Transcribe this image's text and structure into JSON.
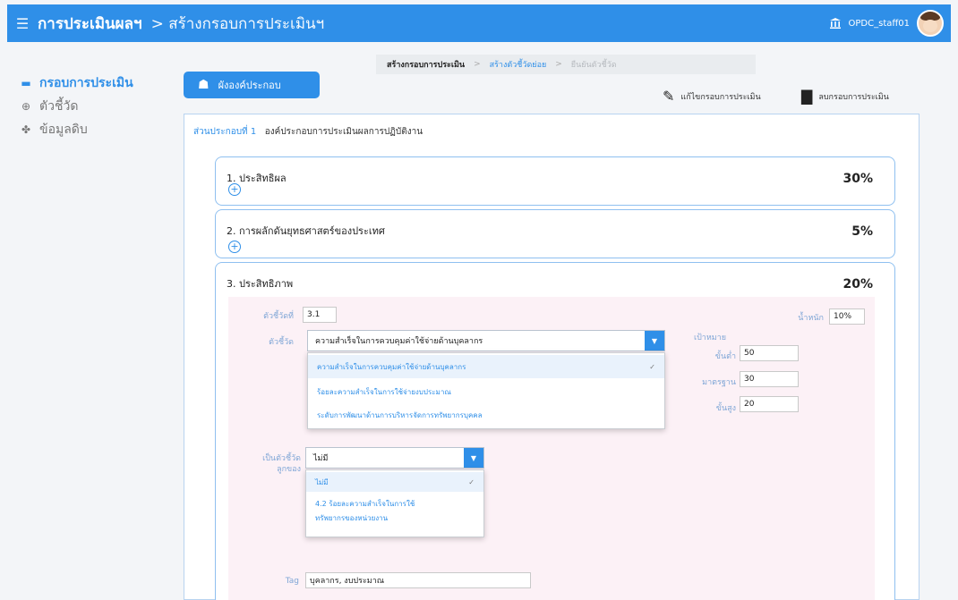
{
  "header": {
    "app_title": "การประเมินผลฯ",
    "breadcrumb": "> สร้างกรอบการประเมินฯ",
    "org_label": "OPDC_staff01",
    "menu_icon": "hamburger-icon",
    "bank_icon": "bank-icon"
  },
  "sidebar": {
    "items": [
      {
        "label": "กรอบการประเมิน",
        "icon": "list-icon",
        "active": true
      },
      {
        "label": "ตัวชี้วัด",
        "icon": "add-circle-icon",
        "active": false
      },
      {
        "label": "ข้อมูลดิบ",
        "icon": "users-icon",
        "active": false
      }
    ]
  },
  "toolbar": {
    "structure_label": "ผังองค์ประกอบ",
    "edit_label": "แก้ไขกรอบการประเมิน",
    "archive_label": "ลบกรอบการประเมิน"
  },
  "steps": {
    "step1": "สร้างกรอบการประเมิน",
    "step2": "สร้างตัวชี้วัดย่อย",
    "step3": "ยืนยันตัวชี้วัด"
  },
  "panel": {
    "section_prefix": "ส่วนประกอบที่ 1",
    "section_title": "องค์ประกอบการประเมินผลการปฏิบัติงาน"
  },
  "cards": [
    {
      "title": "1. ประสิทธิผล",
      "percent": "30%"
    },
    {
      "title": "2. การผลักดันยุทธศาสตร์ของประเทศ",
      "percent": "5%"
    },
    {
      "title": "3. ประสิทธิภาพ",
      "percent": "20%"
    }
  ],
  "form": {
    "kpi_no_label": "ตัวชี้วัดที่",
    "kpi_no_value": "3.1",
    "weight_label": "น้ำหนัก",
    "weight_value": "10%",
    "kpi_label": "ตัวชี้วัด",
    "kpi_selected": "ความสำเร็จในการควบคุมค่าใช้จ่ายด้านบุคลากร",
    "kpi_options": [
      "ความสำเร็จในการควบคุมค่าใช้จ่ายด้านบุคลากร",
      "ร้อยละความสำเร็จในการใช้จ่ายงบประมาณ",
      "ระดับการพัฒนาด้านการบริหารจัดการทรัพยากรบุคคล"
    ],
    "target_label": "เป้าหมาย",
    "min_label": "ขั้นต่ำ",
    "min_value": "50",
    "std_label": "มาตรฐาน",
    "std_value": "30",
    "max_label": "ขั้นสูง",
    "max_value": "20",
    "link_label_1": "เป็นตัวชี้วัด",
    "link_label_2": "ลูกของ",
    "link_selected": "ไม่มี",
    "link_options": [
      "ไม่มี",
      "4.2 ร้อยละความสำเร็จในการใช้",
      "ทรัพยากรของหน่วยงาน"
    ],
    "tag_label": "Tag",
    "tag_value": "บุคลากร, งบประมาณ"
  }
}
